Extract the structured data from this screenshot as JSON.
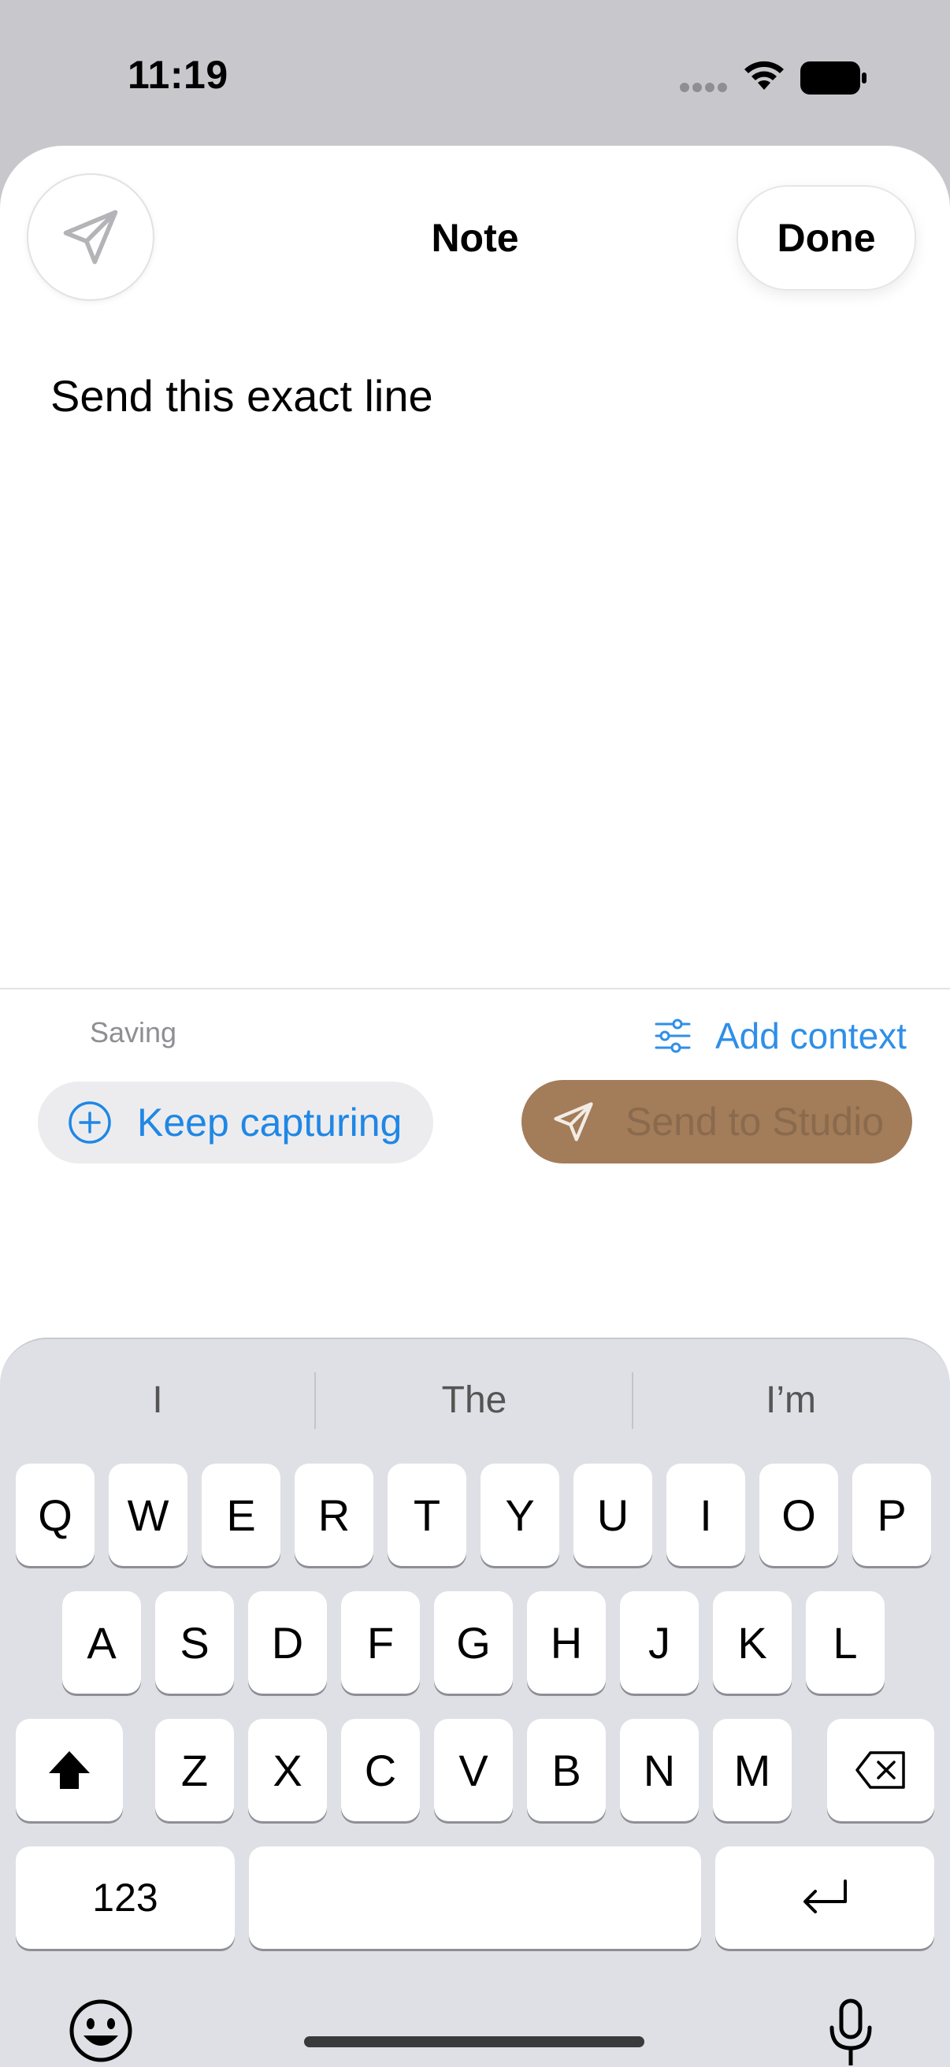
{
  "status": {
    "time": "11:19"
  },
  "sheet": {
    "title": "Note",
    "done_label": "Done",
    "note_text": "Send this exact line"
  },
  "footer": {
    "saving_label": "Saving",
    "add_context_label": "Add context",
    "keep_capturing_label": "Keep capturing",
    "send_to_studio_label": "Send to Studio"
  },
  "keyboard": {
    "suggestions": [
      "I",
      "The",
      "I’m"
    ],
    "row1": [
      "Q",
      "W",
      "E",
      "R",
      "T",
      "Y",
      "U",
      "I",
      "O",
      "P"
    ],
    "row2": [
      "A",
      "S",
      "D",
      "F",
      "G",
      "H",
      "J",
      "K",
      "L"
    ],
    "row3": [
      "Z",
      "X",
      "C",
      "V",
      "B",
      "N",
      "M"
    ],
    "numbers_label": "123"
  },
  "colors": {
    "accent_blue": "#1f87e5",
    "send_button_bg": "#a37c5a"
  }
}
